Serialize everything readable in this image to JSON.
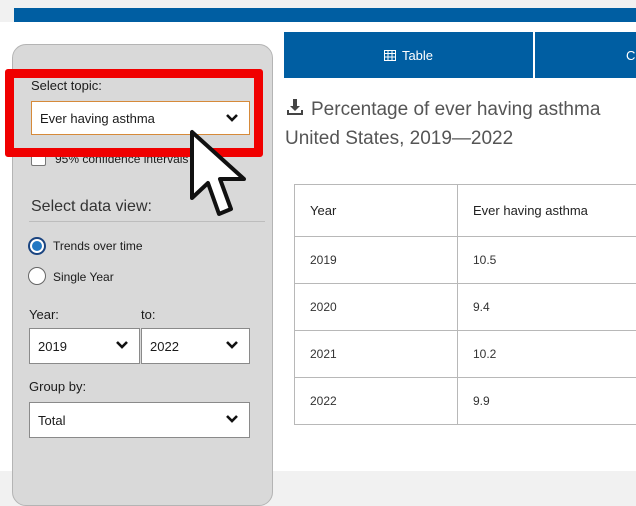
{
  "sidebar": {
    "topic_label": "Select topic:",
    "topic_value": "Ever having asthma",
    "ci_label": "95% confidence intervals",
    "data_view_heading": "Select data view:",
    "view_options": [
      "Trends over time",
      "Single Year"
    ],
    "view_selected": "Trends over time",
    "year_label": "Year:",
    "to_label": "to:",
    "year_from": "2019",
    "year_to": "2022",
    "group_by_label": "Group by:",
    "group_by_value": "Total"
  },
  "tabs": {
    "table_label": "Table",
    "next_label": "C"
  },
  "title": {
    "line1": "Percentage of ever having asthma",
    "line2": "United States, 2019—2022"
  },
  "table": {
    "headers": [
      "Year",
      "Ever having asthma"
    ],
    "rows": [
      [
        "2019",
        "10.5"
      ],
      [
        "2020",
        "9.4"
      ],
      [
        "2021",
        "10.2"
      ],
      [
        "2022",
        "9.9"
      ]
    ]
  },
  "colors": {
    "brand_blue": "#005ea2",
    "highlight_red": "#f00000",
    "radio_blue": "#2378c3"
  },
  "icons": [
    "chevron-down-icon",
    "table-icon",
    "download-icon",
    "mouse-cursor-icon"
  ]
}
